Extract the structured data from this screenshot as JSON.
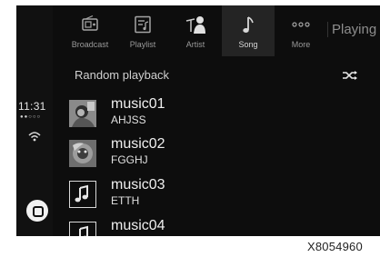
{
  "tabs": [
    {
      "label": "Broadcast",
      "icon": "radio-icon"
    },
    {
      "label": "Playlist",
      "icon": "playlist-icon"
    },
    {
      "label": "Artist",
      "icon": "artist-icon"
    },
    {
      "label": "Song",
      "icon": "music-note-icon"
    },
    {
      "label": "More",
      "icon": "more-dots-icon"
    }
  ],
  "active_tab": "Song",
  "now_playing_label": "Playing",
  "status": {
    "time": "11:31",
    "signal": "●●○○○"
  },
  "random_playback_label": "Random playback",
  "songs": [
    {
      "title": "music01",
      "artist": "AHJSS",
      "art": "photo"
    },
    {
      "title": "music02",
      "artist": "FGGHJ",
      "art": "photo"
    },
    {
      "title": "music03",
      "artist": "ETTH",
      "art": "music-note-icon"
    },
    {
      "title": "music04",
      "artist": "",
      "art": "music-note-icon"
    }
  ],
  "figure_id": "X8054960"
}
